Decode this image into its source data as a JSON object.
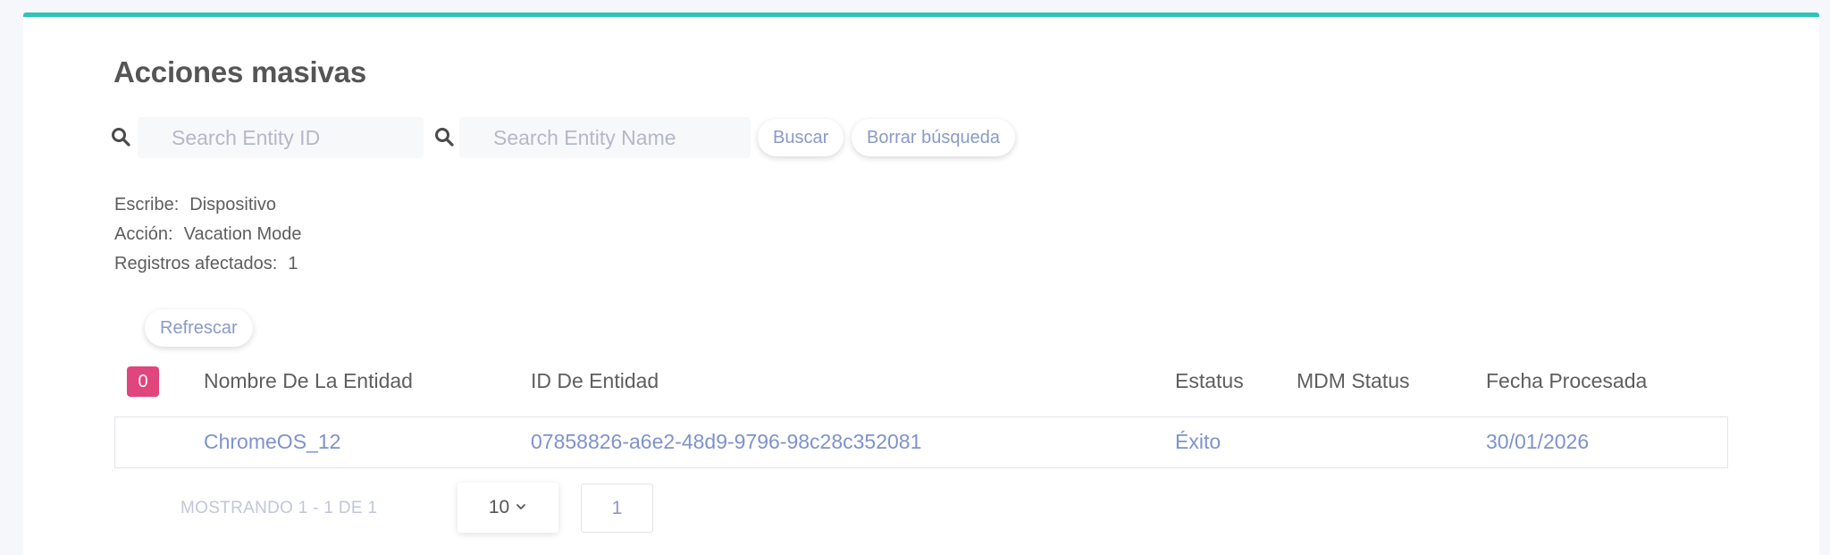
{
  "page": {
    "title": "Acciones masivas"
  },
  "search": {
    "entity_id_placeholder": "Search Entity ID",
    "entity_name_placeholder": "Search Entity Name",
    "search_button": "Buscar",
    "clear_button": "Borrar búsqueda"
  },
  "info": {
    "type_label": "Escribe:",
    "type_value": "Dispositivo",
    "action_label": "Acción:",
    "action_value": "Vacation Mode",
    "records_label": "Registros afectados:",
    "records_value": "1"
  },
  "refresh_button": "Refrescar",
  "table": {
    "selected_count": "0",
    "headers": [
      "Nombre De La Entidad",
      "ID De Entidad",
      "Estatus",
      "MDM Status",
      "Fecha Procesada"
    ],
    "rows": [
      {
        "entity_name": "ChromeOS_12",
        "entity_id": "07858826-a6e2-48d9-9796-98c28c352081",
        "status": "Éxito",
        "mdm_status": "",
        "processed_date": "30/01/2026"
      }
    ]
  },
  "pagination": {
    "showing_text": "MOSTRANDO 1 - 1 DE 1",
    "page_size": "10",
    "current_page": "1"
  },
  "colors": {
    "accent_top_border": "#2ec4b6",
    "badge": "#e0457b",
    "link": "#7e92cc"
  }
}
